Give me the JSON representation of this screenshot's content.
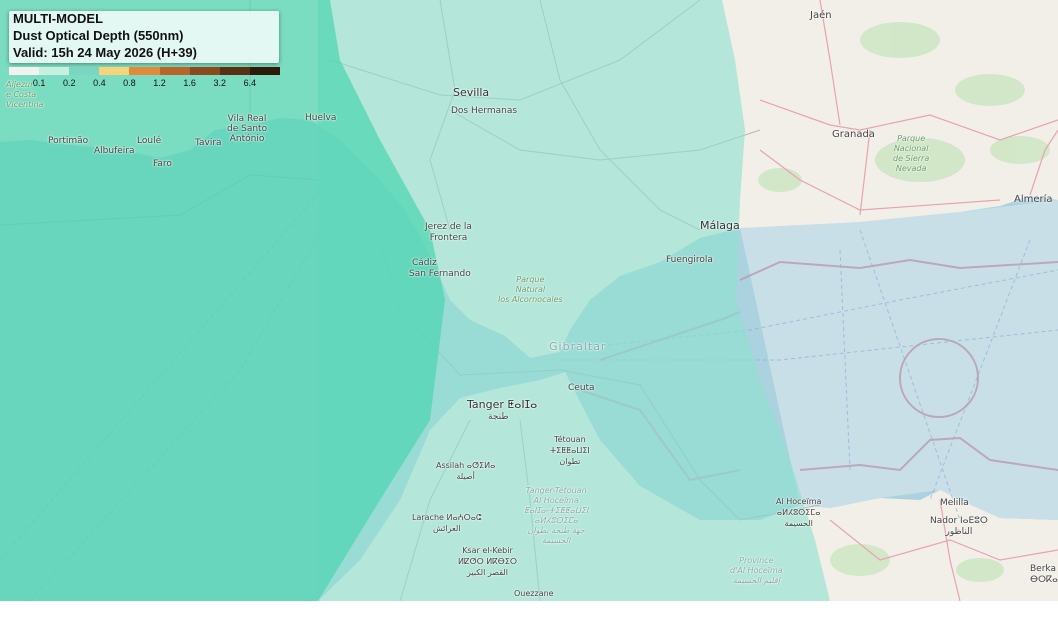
{
  "legend": {
    "model": "MULTI-MODEL",
    "variable": "Dust Optical Depth (550nm)",
    "valid": "Valid: 15h 24 May 2026 (H+39)",
    "ticks": [
      "0.1",
      "0.2",
      "0.4",
      "0.8",
      "1.2",
      "1.6",
      "3.2",
      "6.4"
    ],
    "colors": [
      "#f2f2f2",
      "#c8f0e0",
      "#7ad6c1",
      "#f7d37a",
      "#e08a3a",
      "#b8652a",
      "#8a4a1e",
      "#5a3012",
      "#2e1a08"
    ]
  },
  "places": {
    "jaen": "Jaén",
    "granada": "Granada",
    "sierra_nevada_1": "Parque",
    "sierra_nevada_2": "Nacional",
    "sierra_nevada_3": "de Sierra",
    "sierra_nevada_4": "Nevada",
    "almeria": "Almería",
    "sevilla": "Sevilla",
    "dos_hermanas": "Dos Hermanas",
    "huelva": "Huelva",
    "vila_real_1": "Vila Real",
    "vila_real_2": "de Santo",
    "vila_real_3": "António",
    "tavira": "Tavira",
    "loule": "Loulé",
    "portimao": "Portimão",
    "albufeira": "Albufeira",
    "faro": "Faro",
    "aljezur": "Aljezur",
    "costa_vicentina_1": "e Costa",
    "costa_vicentina_2": "Vicentina",
    "jerez_1": "Jerez de la",
    "jerez_2": "Frontera",
    "cadiz": "Cádiz",
    "san_fernando": "San Fernando",
    "alcornocales_1": "Parque",
    "alcornocales_2": "Natural",
    "alcornocales_3": "los Alcornocales",
    "malaga": "Málaga",
    "fuengirola": "Fuengirola",
    "gibraltar": "Gibraltar",
    "ceuta": "Ceuta",
    "tanger": "Tanger ⵟⴰⵏⵊⴰ",
    "tanger_ar": "طنجة",
    "tetouan_1": "Tétouan",
    "tetouan_2": "ⵜⵉⵟⵟⴰⵡⵉⵏ",
    "tetouan_3": "تطوان",
    "tanger_tetouan_1": "Tanger-Tétouan",
    "tanger_tetouan_2": "Al Hoceïma",
    "tanger_tetouan_3": "ⵟⴰⵏⵊⴰ-ⵜⵉⵟⵟⴰⵡⵉⵏ",
    "tanger_tetouan_4": "ⴰⵍⵃⵓⵙⵉⵎⴰ",
    "tanger_tetouan_5": "جهة طنجة تطوان",
    "tanger_tetouan_6": "الحسيمة",
    "assilah_1": "Assilah ⴰⵚⵉⵍⴰ",
    "assilah_2": "أصيلة",
    "larache_1": "Larache ⵍⴰⵄⵔⴰⵛ",
    "larache_2": "العرائش",
    "ksar_1": "Ksar el-Kebir",
    "ksar_2": "ⵍⵇⵚⵔ ⵍⴽⴱⵉⵔ",
    "ksar_3": "القصر الكبير",
    "ouezzane": "Ouezzane",
    "al_hoceima_1": "Al Hoceïma",
    "al_hoceima_2": "ⴰⵍⵃⵓⵙⵉⵎⴰ",
    "al_hoceima_3": "الحسيمة",
    "province_1": "Province",
    "province_2": "d'Al Hoceïma",
    "province_3": "إقليم الحسيمة",
    "melilla": "Melilla",
    "nador_1": "Nador ⵏⴰⴹⵓⵔ",
    "nador_2": "الناظور",
    "berkane_1": "Berka",
    "berkane_2": "ⴱⵔⴽⴰ"
  }
}
